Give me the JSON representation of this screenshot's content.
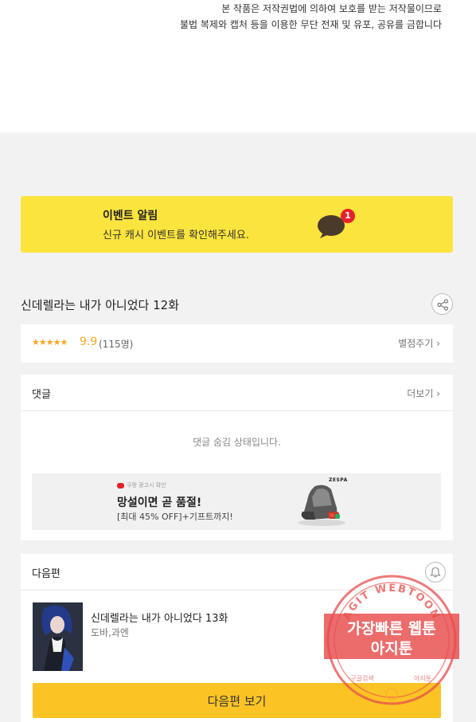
{
  "copyright_notice": {
    "line1": "본 작품은 저작권법에 의하여 보호를 받는 저작물이므로",
    "line2": "불법 복제와 캡처 등을 이용한 무단 전재 및 유포, 공유를 금합니다"
  },
  "event_banner": {
    "title": "이벤트 알림",
    "description": "신규 캐시 이벤트를 확인해주세요.",
    "badge_count": "1",
    "icon": "chat-bubble-icon",
    "background_color": "#fbe43d",
    "badge_color": "#e8202a"
  },
  "episode": {
    "title": "신데렐라는 내가 아니었다 12화",
    "share_icon": "share-icon"
  },
  "rating": {
    "stars": "★★★★★",
    "score": "9.9",
    "count": "(115명)",
    "rate_link": "별점주기 ›",
    "star_color": "#f5a623"
  },
  "comments": {
    "header": "댓글",
    "more_link": "더보기 ›",
    "hidden_message": "댓글 숨김 상태입니다."
  },
  "ad": {
    "sponsor": "쿠팡 광고시 확인",
    "headline": "망설이면 곧 품절!",
    "subline": "[최대 45% OFF]+기프트까지!",
    "brand": "ZESPA"
  },
  "next_episode": {
    "header": "다음편",
    "title": "신데렐라는 내가 아니었다 13화",
    "author": "도바,과엔",
    "button_label": "다음편 보기",
    "button_color": "#fbc424",
    "bell_icon": "bell-icon"
  },
  "watermark": {
    "arc_text": "AGIT WEBTOON",
    "line1": "가장빠른 웹툰",
    "line2": "아지툰",
    "bottom_left": "구글검색",
    "bottom_right": "아지툰",
    "color": "#e84c4c"
  }
}
